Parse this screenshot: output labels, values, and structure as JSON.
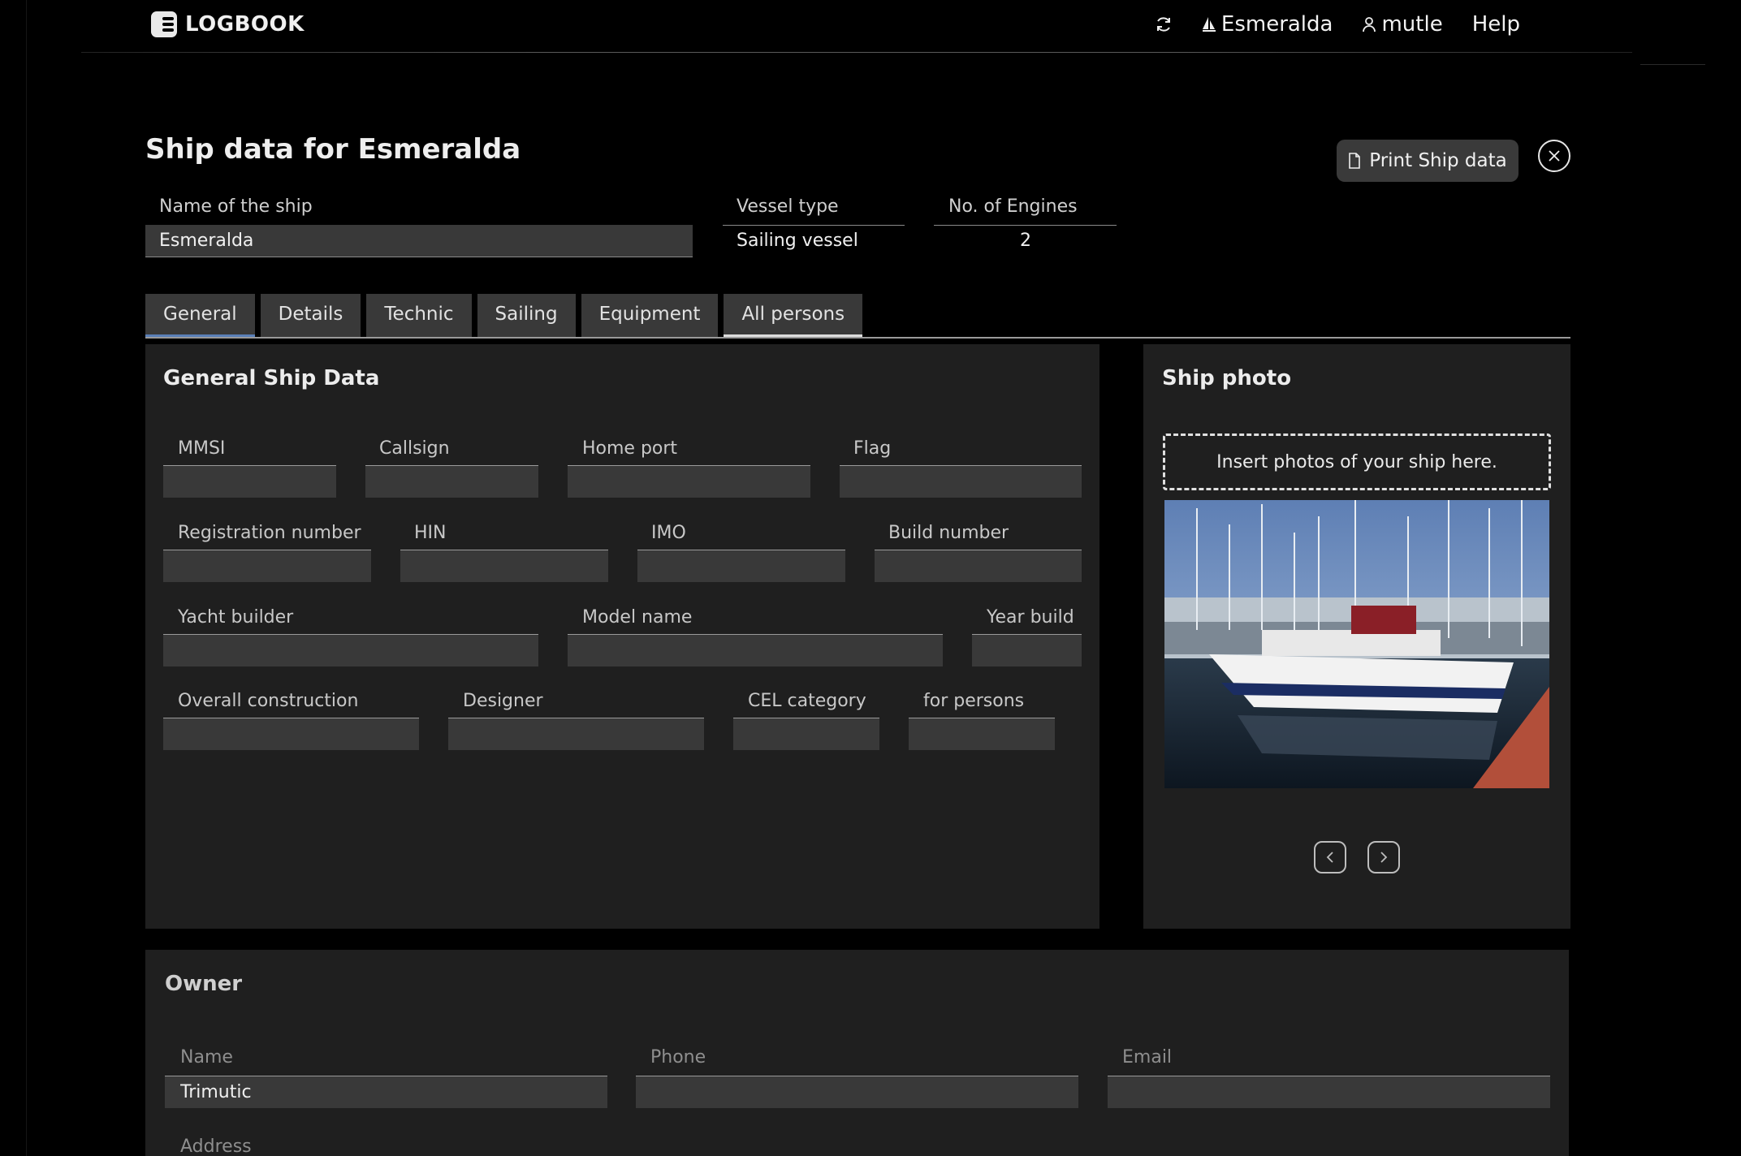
{
  "app": {
    "brand": "LOGBOOK"
  },
  "nav": {
    "ship": "Esmeralda",
    "user": "mutle",
    "help": "Help"
  },
  "page": {
    "title": "Ship data for Esmeralda",
    "print_label": "Print Ship data"
  },
  "header_fields": {
    "name_label": "Name of the ship",
    "name_value": "Esmeralda",
    "vessel_label": "Vessel type",
    "vessel_value": "Sailing vessel",
    "engines_label": "No. of Engines",
    "engines_value": "2"
  },
  "tabs": [
    {
      "label": "General"
    },
    {
      "label": "Details"
    },
    {
      "label": "Technic"
    },
    {
      "label": "Sailing"
    },
    {
      "label": "Equipment"
    },
    {
      "label": "All persons"
    }
  ],
  "general": {
    "title": "General Ship Data",
    "fields": {
      "mmsi": "MMSI",
      "callsign": "Callsign",
      "home_port": "Home port",
      "flag": "Flag",
      "registration": "Registration number",
      "hin": "HIN",
      "imo": "IMO",
      "build_number": "Build number",
      "yacht_builder": "Yacht builder",
      "model_name": "Model name",
      "year_build": "Year build",
      "overall_construction": "Overall construction",
      "designer": "Designer",
      "cel_category": "CEL category",
      "for_persons": "for persons"
    }
  },
  "photo": {
    "title": "Ship photo",
    "drop_text": "Insert photos of your ship here."
  },
  "owner": {
    "title": "Owner",
    "name_label": "Name",
    "name_value": "Trimutic",
    "phone_label": "Phone",
    "email_label": "Email",
    "address_label": "Address"
  },
  "colors": {
    "background": "#000000",
    "panel": "#1f1f1f",
    "input": "#393939",
    "tab_active_underline": "#5a7fb8"
  }
}
